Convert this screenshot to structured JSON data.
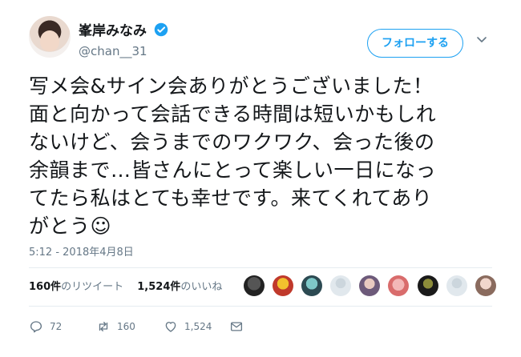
{
  "tweet": {
    "display_name": "峯岸みなみ",
    "handle": "@chan__31",
    "follow_label": "フォローする",
    "text": "写メ会&サイン会ありがとうございました！\n面と向かって会話できる時間は短いかもしれ\nないけど、会うまでのワクワク、会った後の\n余韻まで…皆さんにとって楽しい一日になっ\nてたら私はとても幸せです。来てくれてあり\nがとう☺",
    "timestamp": "5:12 - 2018年4月8日"
  },
  "stats": {
    "retweets_count": "160件",
    "retweets_label": "のリツイート",
    "likes_count": "1,524件",
    "likes_label": "のいいね"
  },
  "actions": {
    "reply_count": "72",
    "retweet_count": "160",
    "like_count": "1,524"
  },
  "colors": {
    "accent": "#1da1f2",
    "muted_text": "#657786",
    "divider": "#e6ecf0"
  },
  "icons": [
    "verified-icon",
    "chevron-down-icon",
    "reply-icon",
    "retweet-icon",
    "heart-icon",
    "envelope-icon"
  ]
}
